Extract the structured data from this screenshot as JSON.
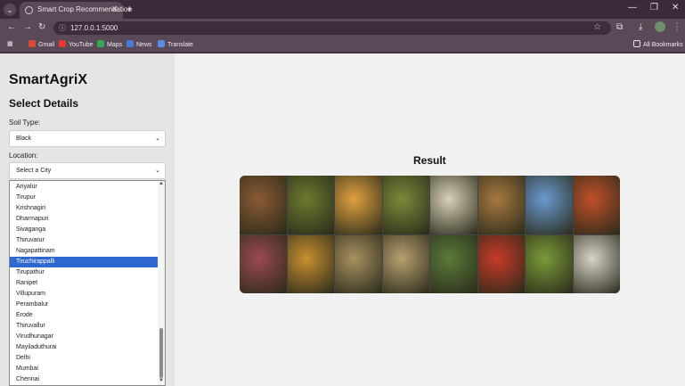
{
  "browser": {
    "tab_title": "Smart Crop Recommendation",
    "url": "127.0.0.1:5000",
    "bookmarks": [
      {
        "label": "Gmail",
        "color": "#d84a38"
      },
      {
        "label": "YouTube",
        "color": "#e53935"
      },
      {
        "label": "Maps",
        "color": "#34a853"
      },
      {
        "label": "News",
        "color": "#4a7bd6"
      },
      {
        "label": "Translate",
        "color": "#5b8de8"
      }
    ],
    "all_bookmarks": "All Bookmarks"
  },
  "sidebar": {
    "brand": "SmartAgriX",
    "section_title": "Select Details",
    "soil_label": "Soil Type:",
    "soil_value": "Black",
    "location_label": "Location:",
    "location_value": "Select a City",
    "city_options": [
      "Ariyalur",
      "Tirupur",
      "Krishnagiri",
      "Dharmapuri",
      "Sivaganga",
      "Thiruvarur",
      "Nagapattinam",
      "Tiruchirappalli",
      "Tirupathur",
      "Ranipet",
      "Villupuram",
      "Perambalur",
      "Erode",
      "Thiruvallur",
      "Virudhunagar",
      "Mayiladuthurai",
      "Delhi",
      "Mumbai",
      "Chennai"
    ],
    "selected_city_index": 7
  },
  "result": {
    "title": "Result",
    "tiles": [
      "#8a5a34",
      "#6b7a2e",
      "#e0a040",
      "#7a8a3a",
      "#d8d0b8",
      "#a87840",
      "#6a9ad0",
      "#c0502a",
      "#9a4a50",
      "#c89030",
      "#a89060",
      "#b8a070",
      "#5a7a3a",
      "#c83a28",
      "#7a9a3a",
      "#d8d4c8"
    ]
  }
}
